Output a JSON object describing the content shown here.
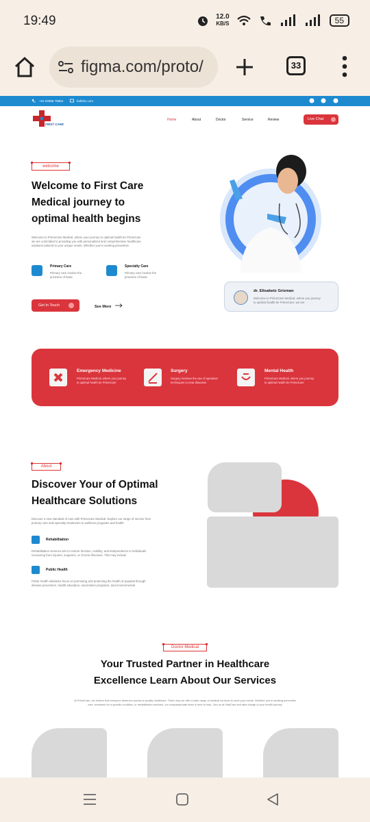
{
  "status_bar": {
    "time": "19:49",
    "net_speed_value": "12.0",
    "net_speed_unit": "KB/S",
    "battery": "55"
  },
  "browser": {
    "url": "figma.com/proto/",
    "tab_count": "33"
  },
  "topstrip": {
    "phone": "+91 92858 78963",
    "email": "hellohc.com"
  },
  "brand": {
    "logo_text": "FIRST CARE",
    "colors": {
      "primary": "#da353c",
      "strip": "#1d8ad0"
    }
  },
  "nav": {
    "links": [
      "Home",
      "About",
      "Doctor",
      "Service",
      "Review"
    ],
    "live_chat": "Live Chat"
  },
  "hero": {
    "tag": "welcome",
    "title_line1": "Welcome to First Care",
    "title_line2": "Medical journey to",
    "title_line3": "optimal health begins",
    "desc_line1": "Welcome to PrimeCare Medical, where your journey to optimal health be PrimeCare",
    "desc_line2": "we are committed to providing you with personalized and comprehensive healthcare",
    "desc_line3": "solutions tailored to your unique needs. Whether you're seeking preventive",
    "feature1_title": "Primary Care",
    "feature1_desc1": "Primary care involve the",
    "feature1_desc2": "provision of basic",
    "feature2_title": "Specialty Care",
    "feature2_desc1": "Primary care involve the",
    "feature2_desc2": "provision of basic",
    "cta": "Get In Touch",
    "see_more": "See More",
    "doctor_name": "dr. Elisabetz Grizman",
    "doctor_desc1": "Welcome to PrimeCare Medical, where you journey",
    "doctor_desc2": "to optimal health be PrimeCare, we are"
  },
  "services": [
    {
      "title": "Emergency Medicine",
      "desc1": "PrimeCare Medical, where you journey",
      "desc2": "to optimal health be PrimeCare"
    },
    {
      "title": "Surgery",
      "desc1": "Surgery involves the use of operative",
      "desc2": "techniques to treat diseases"
    },
    {
      "title": "Mental Health",
      "desc1": "PrimeCare Medical, where you journey",
      "desc2": "to optimal health be PrimeCare"
    }
  ],
  "about": {
    "tag": "About",
    "title_line1": "Discover Your of Optimal",
    "title_line2": "Healthcare Solutions",
    "desc1": "Discover a new standard of care with PrimeCare Medical. Explore our range of service from",
    "desc2": "primary care and specialty treatments to wellness programs and health",
    "item1_title": "Rehabilitation",
    "item1_desc1": "Rehabilitation services aim to restore function, mobility, and independence to individuals",
    "item1_desc2": "recovering from injuries, surgeries, or chronic illnesses. This may include",
    "item2_title": "Public Health",
    "item2_desc1": "Public health initiatives focus on promoting and protecting the health of populati through",
    "item2_desc2": "disease prevention, health education, vaccination programs, and environmental"
  },
  "doctor_section": {
    "tag": "Doctor Medical",
    "title_line1": "Your Trusted Partner in Healthcare",
    "title_line2": "Excellence Learn About Our Services",
    "desc1": "At PrimeCare, we believe that everyone deserves access to quality healthcare. That's why we offer a wide range of medical services to meet your needs. Whether you're seeking preventive",
    "desc2": "care, treatment for a specific condition, or rehabilitation services, our compassionate team is here to help. Join us at VitalCare and take charge of your health journey"
  }
}
